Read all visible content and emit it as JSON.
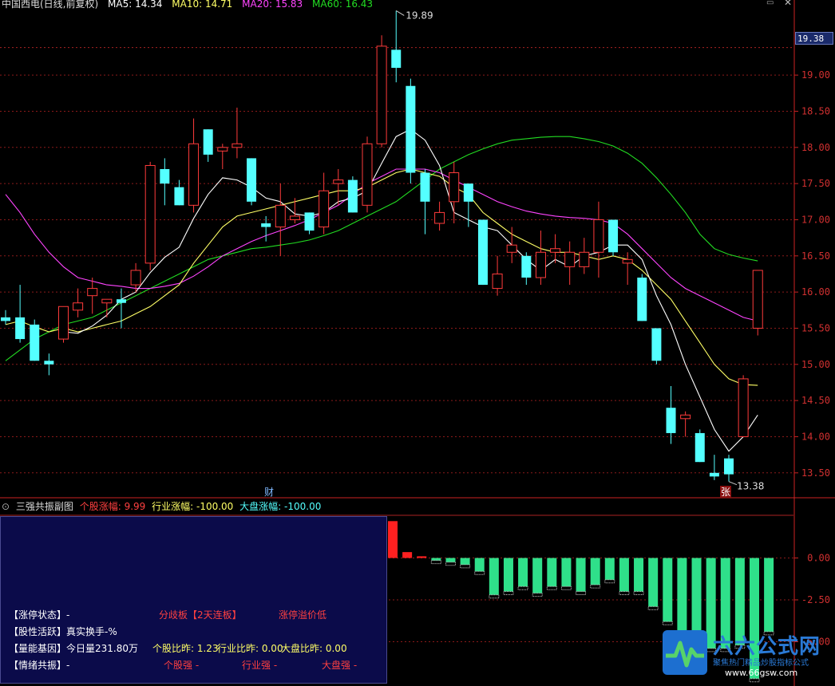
{
  "header": {
    "title": "中国西电(日线,前复权)",
    "ma5": "MA5: 14.34",
    "ma10": "MA10: 14.71",
    "ma20": "MA20: 15.83",
    "ma60": "MA60: 16.43"
  },
  "colors": {
    "up": "#ff3b3b",
    "down": "#54ffff",
    "ma5": "#ffffff",
    "ma10": "#ffff66",
    "ma20": "#ff44ff",
    "ma60": "#22dd22",
    "grid": "#8b1a1a",
    "axis": "#cc2222"
  },
  "price_marker": "19.38",
  "markers": {
    "high_label": "19.89",
    "low_label": "13.38",
    "cai": "财",
    "zhang": "张"
  },
  "chart_data": [
    {
      "type": "candlestick",
      "title": "中国西电(日线,前复权)",
      "ylim": [
        13.2,
        19.95
      ],
      "y_ticks": [
        13.5,
        14.0,
        14.5,
        15.0,
        15.5,
        16.0,
        16.5,
        17.0,
        17.5,
        18.0,
        18.5,
        19.0
      ],
      "candles": [
        {
          "o": 15.65,
          "h": 15.75,
          "l": 15.55,
          "c": 15.6
        },
        {
          "o": 15.65,
          "h": 16.1,
          "l": 15.3,
          "c": 15.35
        },
        {
          "o": 15.55,
          "h": 15.62,
          "l": 15.05,
          "c": 15.05
        },
        {
          "o": 15.05,
          "h": 15.15,
          "l": 14.85,
          "c": 15.0
        },
        {
          "o": 15.35,
          "h": 15.8,
          "l": 15.3,
          "c": 15.8
        },
        {
          "o": 15.75,
          "h": 16.05,
          "l": 15.65,
          "c": 15.85
        },
        {
          "o": 15.95,
          "h": 16.2,
          "l": 15.7,
          "c": 16.05
        },
        {
          "o": 15.85,
          "h": 15.9,
          "l": 15.65,
          "c": 15.9
        },
        {
          "o": 15.9,
          "h": 16.05,
          "l": 15.5,
          "c": 15.85
        },
        {
          "o": 16.1,
          "h": 16.4,
          "l": 16.0,
          "c": 16.3
        },
        {
          "o": 16.4,
          "h": 17.8,
          "l": 16.3,
          "c": 17.75
        },
        {
          "o": 17.7,
          "h": 17.85,
          "l": 17.2,
          "c": 17.5
        },
        {
          "o": 17.45,
          "h": 17.55,
          "l": 17.2,
          "c": 17.2
        },
        {
          "o": 17.2,
          "h": 18.4,
          "l": 17.1,
          "c": 18.05
        },
        {
          "o": 18.25,
          "h": 18.25,
          "l": 17.8,
          "c": 17.9
        },
        {
          "o": 17.95,
          "h": 18.05,
          "l": 17.7,
          "c": 18.0
        },
        {
          "o": 18.0,
          "h": 18.55,
          "l": 17.85,
          "c": 18.05
        },
        {
          "o": 17.85,
          "h": 17.85,
          "l": 17.2,
          "c": 17.25
        },
        {
          "o": 16.95,
          "h": 17.05,
          "l": 16.7,
          "c": 16.9
        },
        {
          "o": 16.9,
          "h": 17.5,
          "l": 16.5,
          "c": 17.2
        },
        {
          "o": 17.0,
          "h": 17.3,
          "l": 16.95,
          "c": 17.05
        },
        {
          "o": 17.1,
          "h": 17.1,
          "l": 16.8,
          "c": 16.85
        },
        {
          "o": 16.9,
          "h": 17.65,
          "l": 16.8,
          "c": 17.4
        },
        {
          "o": 17.5,
          "h": 17.7,
          "l": 17.2,
          "c": 17.55
        },
        {
          "o": 17.55,
          "h": 17.6,
          "l": 17.1,
          "c": 17.1
        },
        {
          "o": 17.2,
          "h": 18.15,
          "l": 17.1,
          "c": 18.05
        },
        {
          "o": 18.05,
          "h": 19.55,
          "l": 18.0,
          "c": 19.4
        },
        {
          "o": 19.35,
          "h": 19.89,
          "l": 18.9,
          "c": 19.1
        },
        {
          "o": 18.85,
          "h": 18.95,
          "l": 17.5,
          "c": 17.65
        },
        {
          "o": 17.65,
          "h": 17.7,
          "l": 16.8,
          "c": 17.25
        },
        {
          "o": 16.95,
          "h": 17.25,
          "l": 16.85,
          "c": 17.1
        },
        {
          "o": 17.25,
          "h": 17.8,
          "l": 16.95,
          "c": 17.65
        },
        {
          "o": 17.5,
          "h": 17.5,
          "l": 16.9,
          "c": 17.25
        },
        {
          "o": 17.0,
          "h": 17.0,
          "l": 16.1,
          "c": 16.1
        },
        {
          "o": 16.05,
          "h": 16.5,
          "l": 15.95,
          "c": 16.25
        },
        {
          "o": 16.55,
          "h": 16.9,
          "l": 16.4,
          "c": 16.65
        },
        {
          "o": 16.5,
          "h": 16.55,
          "l": 16.1,
          "c": 16.2
        },
        {
          "o": 16.2,
          "h": 16.85,
          "l": 16.1,
          "c": 16.55
        },
        {
          "o": 16.55,
          "h": 16.8,
          "l": 16.4,
          "c": 16.6
        },
        {
          "o": 16.35,
          "h": 16.7,
          "l": 16.1,
          "c": 16.55
        },
        {
          "o": 16.35,
          "h": 16.75,
          "l": 16.25,
          "c": 16.55
        },
        {
          "o": 16.55,
          "h": 17.25,
          "l": 16.2,
          "c": 17.0
        },
        {
          "o": 17.0,
          "h": 17.0,
          "l": 16.5,
          "c": 16.55
        },
        {
          "o": 16.4,
          "h": 16.55,
          "l": 16.1,
          "c": 16.45
        },
        {
          "o": 16.2,
          "h": 16.25,
          "l": 15.6,
          "c": 15.6
        },
        {
          "o": 15.5,
          "h": 15.5,
          "l": 15.0,
          "c": 15.05
        },
        {
          "o": 14.4,
          "h": 14.7,
          "l": 13.9,
          "c": 14.05
        },
        {
          "o": 14.25,
          "h": 14.35,
          "l": 14.0,
          "c": 14.3
        },
        {
          "o": 14.05,
          "h": 14.1,
          "l": 13.65,
          "c": 13.65
        },
        {
          "o": 13.5,
          "h": 13.75,
          "l": 13.4,
          "c": 13.45
        },
        {
          "o": 13.7,
          "h": 13.75,
          "l": 13.38,
          "c": 13.48
        },
        {
          "o": 14.0,
          "h": 14.85,
          "l": 14.0,
          "c": 14.8
        },
        {
          "o": 15.5,
          "h": 16.3,
          "l": 15.4,
          "c": 16.3
        }
      ],
      "ma5": [
        null,
        null,
        null,
        null,
        15.45,
        15.43,
        15.53,
        15.68,
        15.9,
        16.0,
        16.27,
        16.48,
        16.62,
        17.02,
        17.35,
        17.58,
        17.55,
        17.45,
        17.3,
        17.25,
        17.08,
        17.05,
        17.1,
        17.25,
        17.3,
        17.4,
        17.78,
        18.15,
        18.25,
        18.1,
        17.75,
        17.1,
        17.0,
        16.9,
        16.85,
        16.65,
        16.45,
        16.3,
        16.45,
        16.35,
        16.5,
        16.55,
        16.65,
        16.65,
        16.45,
        15.95,
        15.55,
        15.0,
        14.55,
        14.1,
        13.8,
        14.0,
        14.3
      ],
      "ma10": [
        15.55,
        15.6,
        15.52,
        15.45,
        15.5,
        15.45,
        15.5,
        15.55,
        15.6,
        15.7,
        15.8,
        15.95,
        16.1,
        16.4,
        16.65,
        16.9,
        17.05,
        17.1,
        17.15,
        17.2,
        17.25,
        17.3,
        17.35,
        17.4,
        17.4,
        17.45,
        17.55,
        17.65,
        17.7,
        17.65,
        17.6,
        17.45,
        17.35,
        17.1,
        16.95,
        16.8,
        16.7,
        16.6,
        16.55,
        16.55,
        16.5,
        16.45,
        16.5,
        16.45,
        16.3,
        16.1,
        15.9,
        15.6,
        15.3,
        15.0,
        14.8,
        14.72,
        14.71
      ],
      "ma20": [
        17.35,
        17.1,
        16.8,
        16.55,
        16.35,
        16.2,
        16.15,
        16.1,
        16.08,
        16.05,
        16.05,
        16.08,
        16.12,
        16.22,
        16.35,
        16.5,
        16.6,
        16.7,
        16.78,
        16.85,
        16.92,
        17.0,
        17.1,
        17.2,
        17.35,
        17.5,
        17.6,
        17.7,
        17.7,
        17.7,
        17.65,
        17.55,
        17.45,
        17.35,
        17.25,
        17.18,
        17.12,
        17.08,
        17.05,
        17.03,
        17.02,
        17.0,
        16.95,
        16.8,
        16.6,
        16.4,
        16.2,
        16.05,
        15.95,
        15.85,
        15.75,
        15.65,
        15.6
      ],
      "ma60": [
        15.05,
        15.2,
        15.35,
        15.45,
        15.55,
        15.6,
        15.65,
        15.75,
        15.85,
        15.95,
        16.05,
        16.15,
        16.25,
        16.35,
        16.45,
        16.5,
        16.55,
        16.6,
        16.62,
        16.65,
        16.68,
        16.72,
        16.78,
        16.85,
        16.95,
        17.05,
        17.15,
        17.25,
        17.4,
        17.55,
        17.7,
        17.8,
        17.9,
        17.98,
        18.05,
        18.1,
        18.12,
        18.14,
        18.15,
        18.15,
        18.12,
        18.08,
        18.02,
        17.92,
        17.78,
        17.58,
        17.35,
        17.1,
        16.8,
        16.6,
        16.52,
        16.47,
        16.43
      ]
    },
    {
      "type": "bar",
      "title": "三强共振副图",
      "legend": [
        "个股涨幅: 9.99",
        "行业涨幅: -100.00",
        "大盘涨幅: -100.00"
      ],
      "ylim": [
        -7.5,
        2.5
      ],
      "y_ticks": [
        0.0,
        -2.5,
        -5.0
      ],
      "values": [
        2.2,
        0.35,
        0.1,
        -0.15,
        -0.25,
        -0.4,
        -0.8,
        -2.2,
        -2.0,
        -1.7,
        -2.1,
        -1.7,
        -1.7,
        -2.0,
        -1.6,
        -1.3,
        -2.0,
        -2.0,
        -2.9,
        -3.8,
        -4.9,
        -4.9,
        -5.4,
        -5.4,
        -5.2,
        -7.2,
        -4.4
      ]
    }
  ],
  "sub_panel": {
    "title": "三强共振副图",
    "legend_stock": "个股涨幅: 9.99",
    "legend_industry": "行业涨幅: -100.00",
    "legend_market": "大盘涨幅: -100.00",
    "row1_label": "【涨停状态】-",
    "row1_mid": "分歧板【2天连板】",
    "row1_right": "涨停溢价低",
    "row2_label": "【股性活跃】真实换手-%",
    "row3_label": "【量能基因】今日量231.80万",
    "row3_stock": "个股比昨: 1.23",
    "row3_industry": "行业比昨: 0.00",
    "row3_market": "大盘比昨: 0.00",
    "row4_label": "【情绪共振】-",
    "row4_stock": "个股强 -",
    "row4_industry": "行业强 -",
    "row4_market": "大盘强 -"
  },
  "logo": {
    "name": "六六公式网",
    "slogan": "聚焦热门精品炒股指标公式",
    "url": "www.66gsw.com"
  }
}
